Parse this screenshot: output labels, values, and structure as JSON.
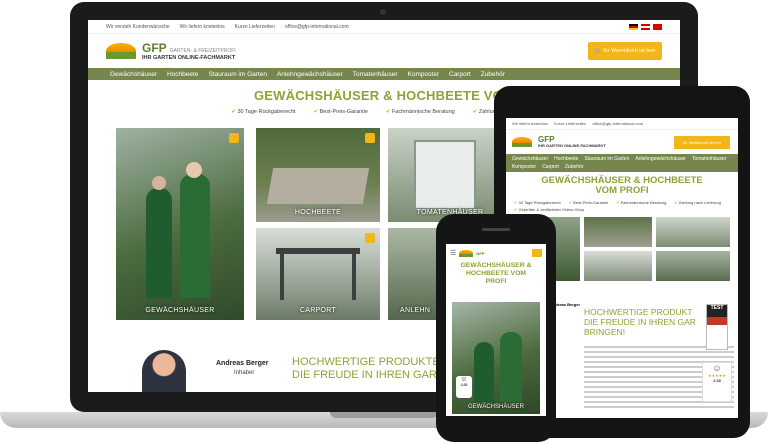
{
  "laptop": {
    "topbar": {
      "items": [
        "Wir versteh Kundenwünsche",
        "Wir liefern kostenlos",
        "Kurze Lieferzeiten",
        "office@gfp-international.com"
      ]
    },
    "logo": {
      "brand": "GFP",
      "sub": "GARTEN- & FREIZEITPROFI",
      "tagline": "IHR GARTEN ONLINE-FACHMARKT"
    },
    "cart_label": "Ihr Warenkorb ist leer",
    "nav": [
      "Gewächshäuser",
      "Hochbeete",
      "Stauraum im Garten",
      "Anlehngewächshäuser",
      "Tomatenhäuser",
      "Komposter",
      "Carport",
      "Zubehör"
    ],
    "hero_title": "GEWÄCHSHÄUSER & HOCHBEETE VOM",
    "usps": [
      "30 Tage Rückgaberecht",
      "Best-Preis-Garantie",
      "Fachmännische Beratung",
      "Zahlung nach Lieferung"
    ],
    "tiles": [
      "GEWÄCHSHÄUSER",
      "HOCHBEETE",
      "TOMATENHÄUSER",
      "CARPORT",
      "ANLEHN"
    ],
    "owner": {
      "name": "Andreas Berger",
      "role": "Inhaber"
    },
    "headline": [
      "HOCHWERTIGE PRODUKTE",
      "DIE FREUDE IN IHREN GARTEN"
    ]
  },
  "tablet": {
    "topbar": [
      "Wir liefern kostenlos",
      "Kurze Lieferzeiten",
      "office@gfp-international.com"
    ],
    "logo": {
      "brand": "GFP",
      "tagline": "IHR GARTEN ONLINE-FACHMARKT"
    },
    "cart_label": "Ihr Warenkorb ist leer",
    "nav": [
      "Gewächshäuser",
      "Hochbeete",
      "Stauraum im Garten",
      "Anlehngewächshäuser",
      "Tomatenhäuser",
      "Komposter",
      "Carport",
      "Zubehör"
    ],
    "title": [
      "GEWÄCHSHÄUSER & HOCHBEETE",
      "VOM PROFI"
    ],
    "usps": [
      "30 Tage Rückgaberecht",
      "Best-Preis-Garantie",
      "Fachmännische Beratung",
      "Zahlung nach Lieferung",
      "Geprüfter & zertifizierter Online-Shop"
    ],
    "owner": "Andreas Berger",
    "headline": [
      "HOCHWERTIGE PRODUKT",
      "DIE FREUDE IN IHREN GAR",
      "BRINGEN!"
    ],
    "seal": "TEST",
    "rating": "4.88"
  },
  "phone": {
    "title": [
      "GEWÄCHSHÄUSER &",
      "HOCHBEETE VOM",
      "PROFI"
    ],
    "tile_label": "GEWÄCHSHÄUSER",
    "rating": "4.88"
  },
  "colors": {
    "brand_green": "#76874e",
    "headline_green": "#8ea235",
    "accent_yellow": "#f2b61a"
  }
}
